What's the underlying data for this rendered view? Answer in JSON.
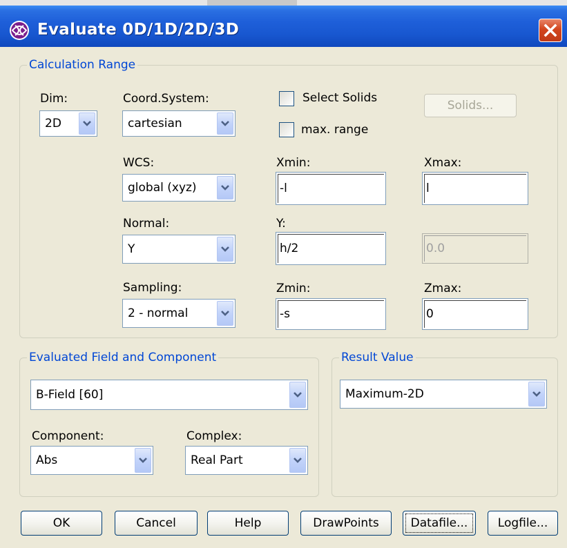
{
  "window": {
    "title": "Evaluate 0D/1D/2D/3D"
  },
  "calculation_range": {
    "legend": "Calculation Range",
    "dim": {
      "label": "Dim:",
      "value": "2D"
    },
    "coord_system": {
      "label": "Coord.System:",
      "value": "cartesian"
    },
    "select_solids": {
      "label": "Select Solids",
      "checked": false
    },
    "max_range": {
      "label": "max. range",
      "checked": false
    },
    "solids_button": "Solids...",
    "wcs": {
      "label": "WCS:",
      "value": "global (xyz)"
    },
    "normal": {
      "label": "Normal:",
      "value": "Y"
    },
    "sampling": {
      "label": "Sampling:",
      "value": "2 - normal"
    },
    "xmin": {
      "label": "Xmin:",
      "value": "-l"
    },
    "xmax": {
      "label": "Xmax:",
      "value": "l"
    },
    "y": {
      "label": "Y:",
      "value": "h/2"
    },
    "y_right": {
      "value": "0.0"
    },
    "zmin": {
      "label": "Zmin:",
      "value": "-s"
    },
    "zmax": {
      "label": "Zmax:",
      "value": "0"
    }
  },
  "evaluated_field": {
    "legend": "Evaluated Field and Component",
    "field": "B-Field [60]",
    "component": {
      "label": "Component:",
      "value": "Abs"
    },
    "complex": {
      "label": "Complex:",
      "value": "Real Part"
    }
  },
  "result_value": {
    "legend": "Result Value",
    "value": "Maximum-2D"
  },
  "buttons": {
    "ok": "OK",
    "cancel": "Cancel",
    "help": "Help",
    "drawpoints": "DrawPoints",
    "datafile": "Datafile...",
    "logfile": "Logfile..."
  },
  "colors": {
    "title_bar": "#1E5FD9",
    "legend_text": "#0046D5",
    "dialog_bg": "#ECE9D8",
    "close_button": "#D2451E"
  },
  "icons": {
    "app": "app-logo-icon",
    "close": "close-icon",
    "dropdown": "chevron-down-icon"
  }
}
